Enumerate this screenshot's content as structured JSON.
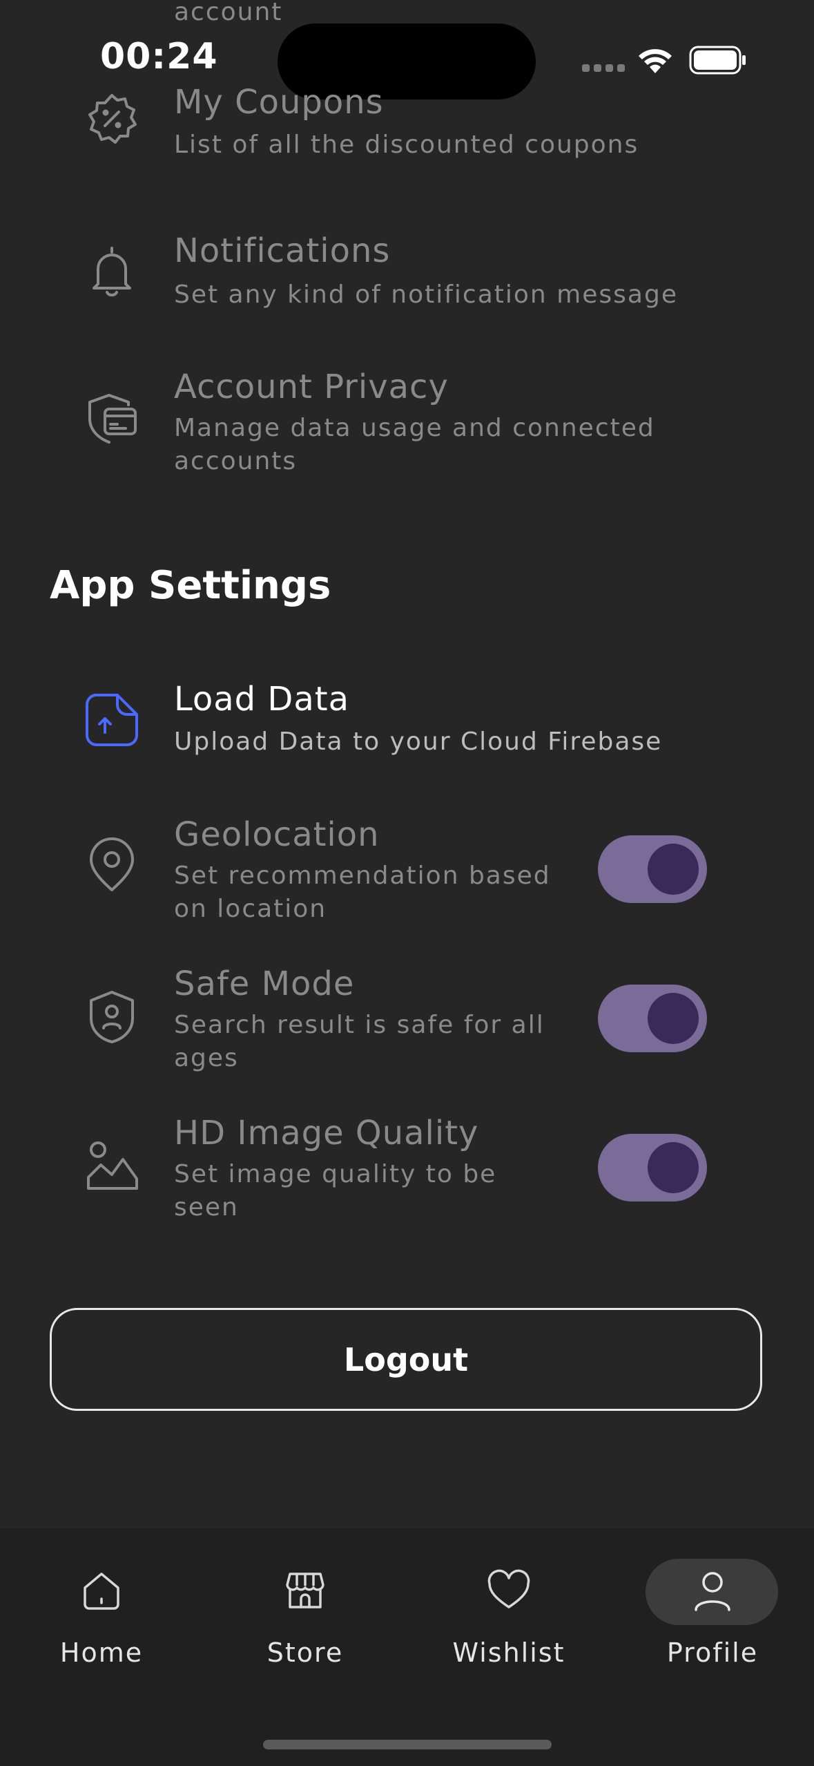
{
  "status_bar": {
    "time": "00:24"
  },
  "account_rows": [
    {
      "title": "",
      "subtitle": "account",
      "icon": "account-icon"
    },
    {
      "title": "My Coupons",
      "subtitle": "List of all the discounted coupons",
      "icon": "coupon-icon"
    },
    {
      "title": "Notifications",
      "subtitle": "Set any kind of notification message",
      "icon": "bell-icon"
    },
    {
      "title": "Account Privacy",
      "subtitle_line1": "Manage data usage and connected",
      "subtitle_line2": "accounts",
      "icon": "privacy-card-icon"
    }
  ],
  "app_settings": {
    "title": "App Settings",
    "load_data": {
      "title": "Load Data",
      "subtitle": "Upload Data to your Cloud Firebase",
      "icon": "upload-document-icon",
      "accent": "#4b68ff"
    },
    "geolocation": {
      "title": "Geolocation",
      "subtitle_line1": "Set recommendation based",
      "subtitle_line2": "on location",
      "icon": "location-pin-icon",
      "enabled": true
    },
    "safe_mode": {
      "title": "Safe Mode",
      "subtitle_line1": "Search result is safe for all",
      "subtitle_line2": "ages",
      "icon": "security-user-icon",
      "enabled": true
    },
    "hd_image": {
      "title": "HD Image Quality",
      "subtitle_line1": "Set image quality to be",
      "subtitle_line2": "seen",
      "icon": "image-icon",
      "enabled": true
    }
  },
  "logout_label": "Logout",
  "nav": {
    "items": [
      {
        "label": "Home",
        "icon": "home-icon"
      },
      {
        "label": "Store",
        "icon": "store-icon"
      },
      {
        "label": "Wishlist",
        "icon": "heart-icon"
      },
      {
        "label": "Profile",
        "icon": "user-icon",
        "active": true
      }
    ]
  },
  "colors": {
    "background": "#262626",
    "toggle_track": "#7a6b98",
    "toggle_knob": "#3a2a5a",
    "accent_blue": "#4b68ff"
  }
}
